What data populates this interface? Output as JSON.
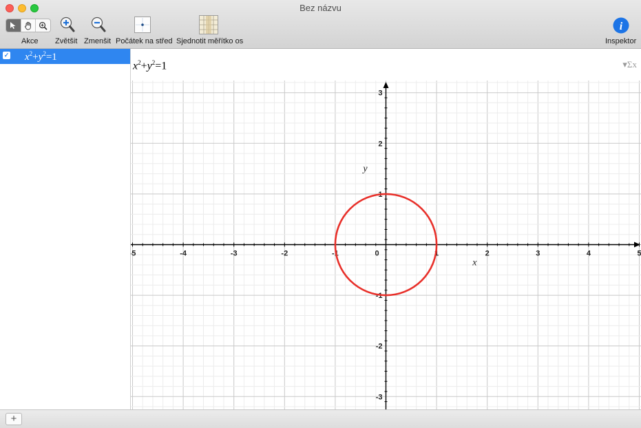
{
  "window": {
    "title": "Bez názvu"
  },
  "toolbar": {
    "actions_label": "Akce",
    "zoom_in_label": "Zvětšit",
    "zoom_out_label": "Zmenšit",
    "center_label": "Počátek na střed",
    "equalize_label": "Sjednotit měřítko os",
    "inspector_label": "Inspektor",
    "tools": [
      {
        "name": "arrow-tool",
        "glyph": "➤",
        "active": true
      },
      {
        "name": "hand-tool",
        "glyph": "✋",
        "active": false
      },
      {
        "name": "zoom-tool",
        "glyph": "⊕",
        "active": false
      }
    ]
  },
  "sidebar": {
    "equations": [
      {
        "label": "x²+y²=1",
        "checked": true
      }
    ],
    "checkmark": "✓"
  },
  "header": {
    "equation": "x²+y²=1",
    "sigma": "▾Σx"
  },
  "footer": {
    "add": "+"
  },
  "graph": {
    "x_ticks": [
      "-5",
      "-4",
      "-3",
      "-2",
      "-1",
      "0",
      "1",
      "2",
      "3",
      "4",
      "5"
    ],
    "y_ticks": [
      "3",
      "2",
      "1",
      "-1",
      "-2",
      "-3"
    ],
    "x_label": "x",
    "y_label": "y",
    "curve_color": "#e8302a",
    "xlim": [
      -5,
      5
    ],
    "ylim": [
      -3.3,
      3.2
    ],
    "circle_radius": 1
  },
  "colors": {
    "selection": "#2f86f0",
    "inspector": "#1c74e6"
  }
}
